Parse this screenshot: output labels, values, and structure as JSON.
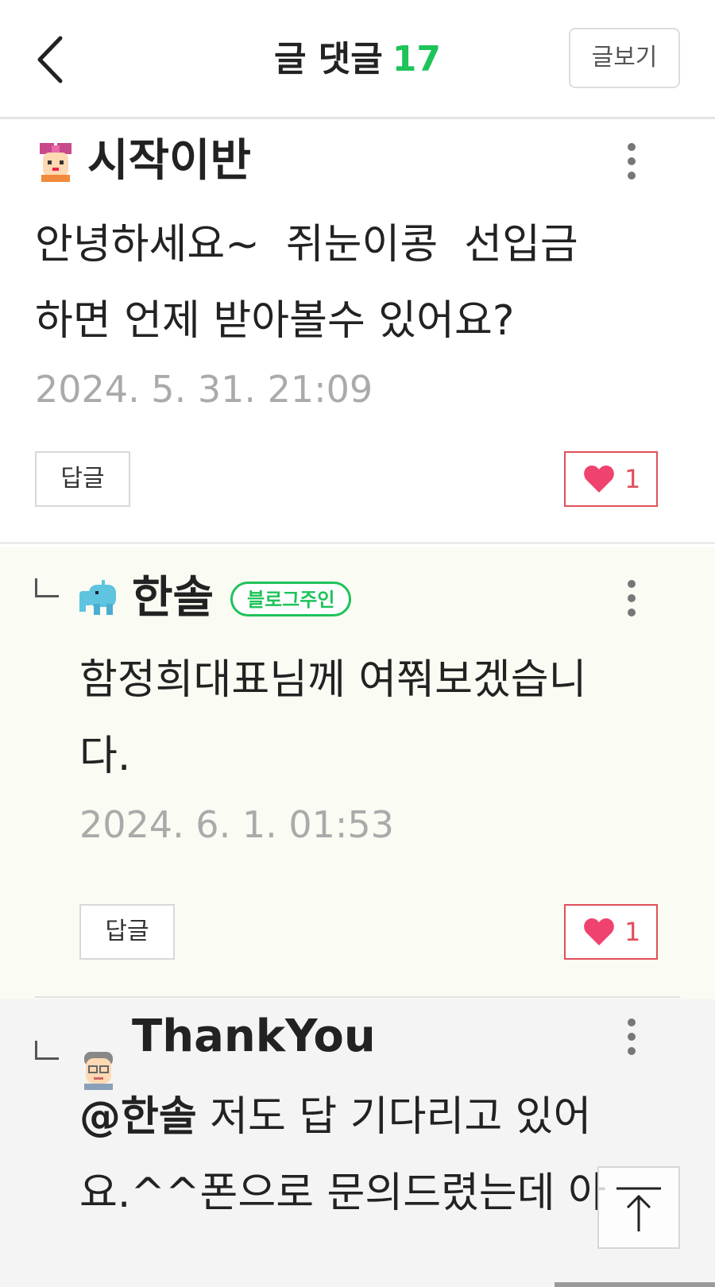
{
  "header": {
    "title": "글 댓글",
    "count": "17",
    "view_post_label": "글보기"
  },
  "comments": [
    {
      "nickname": "시작이반",
      "text": "안녕하세요~  쥐눈이콩  선입금\n하면 언제 받아볼수 있어요?",
      "date": "2024. 5. 31. 21:09",
      "reply_label": "답글",
      "likes": "1"
    },
    {
      "nickname": "한솔",
      "badge": "블로그주인",
      "text": "함정희대표님께 여쭤보겠습니\n다.",
      "date": "2024. 6. 1. 01:53",
      "reply_label": "답글",
      "likes": "1"
    },
    {
      "nickname": "ThankYou",
      "mention": "@한솔",
      "text": " 저도 답 기다리고 있어\n요.^^폰으로 문의드렸는데 아"
    }
  ],
  "colors": {
    "accent_green": "#1ec35a",
    "like_red": "#e0505a",
    "heart_pink": "#f0426f"
  },
  "icons": {
    "back": "chevron-left-icon",
    "more": "more-vertical-icon",
    "like": "heart-icon",
    "reply": "reply-arrow-icon",
    "top": "arrow-up-icon"
  }
}
